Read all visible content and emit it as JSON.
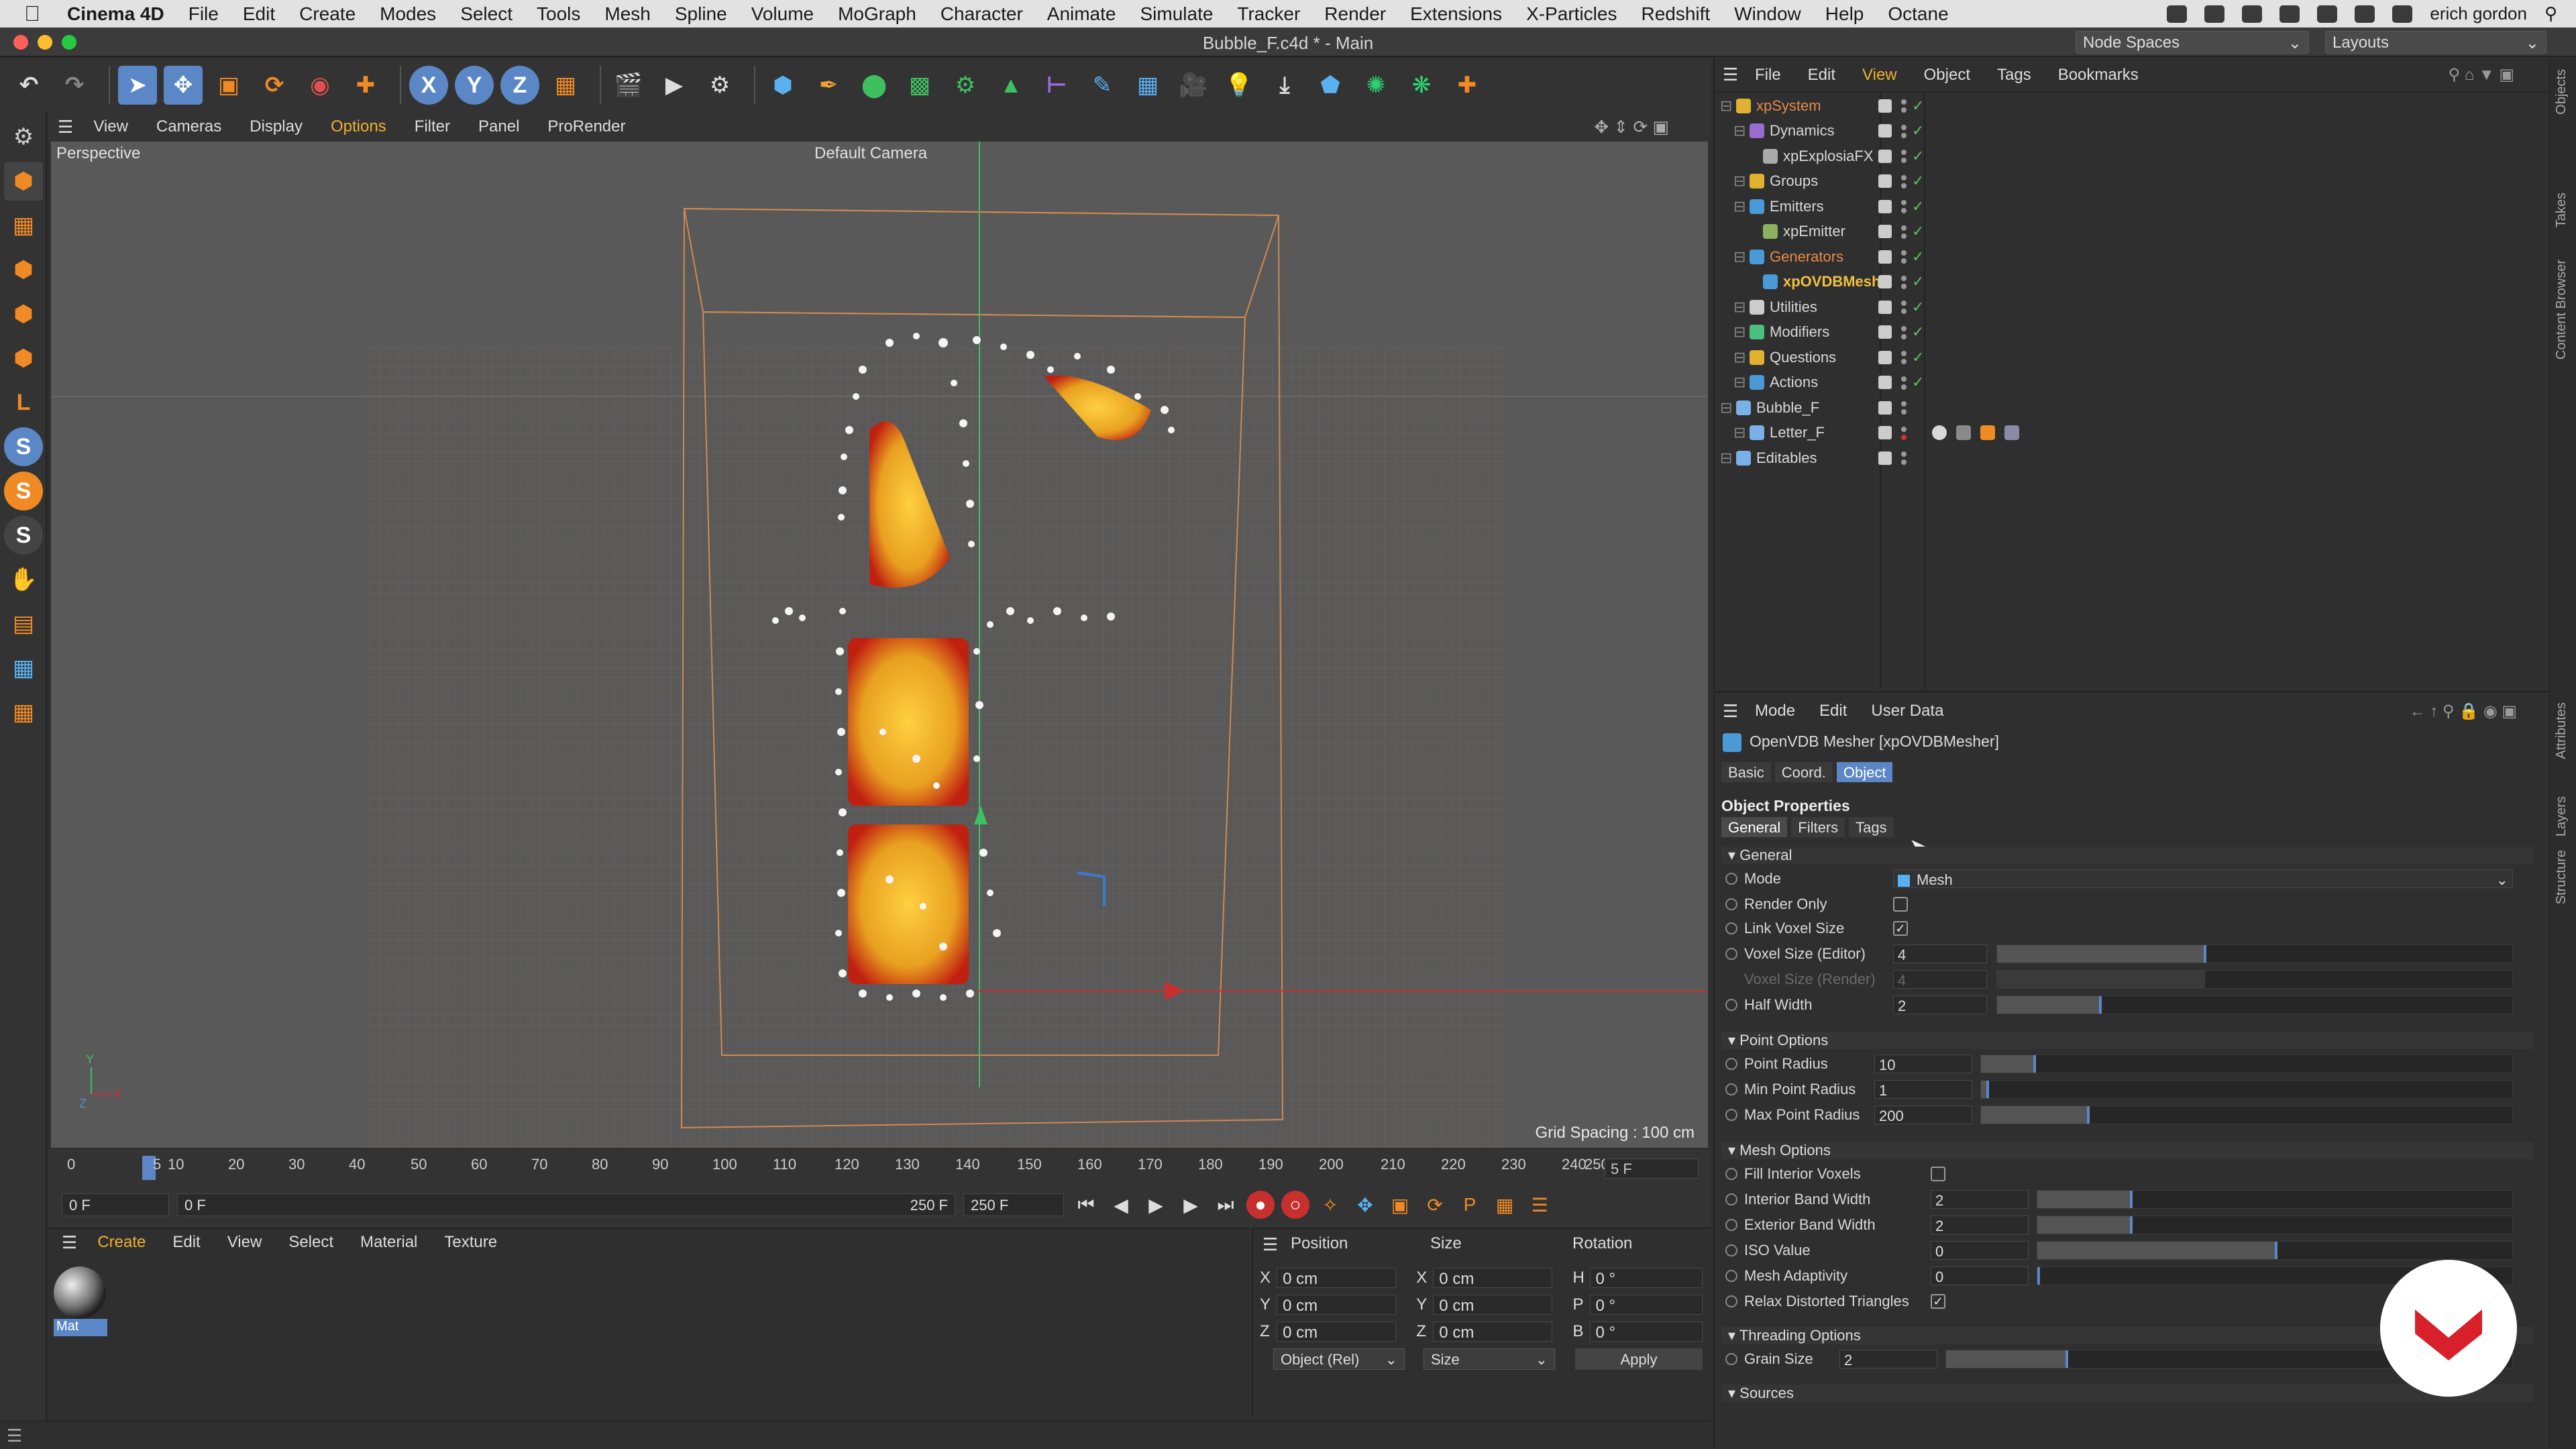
{
  "menubar": {
    "items": [
      "Cinema 4D",
      "File",
      "Edit",
      "Create",
      "Modes",
      "Select",
      "Tools",
      "Mesh",
      "Spline",
      "Volume",
      "MoGraph",
      "Character",
      "Animate",
      "Simulate",
      "Tracker",
      "Render",
      "Extensions",
      "X-Particles",
      "Redshift",
      "Window",
      "Help",
      "Octane"
    ],
    "user": "erich gordon"
  },
  "titlebar": {
    "title": "Bubble_F.c4d * - Main",
    "node_spaces": "Node Spaces",
    "layouts": "Layouts"
  },
  "viewport": {
    "menu": [
      "View",
      "Cameras",
      "Display",
      "Options",
      "Filter",
      "Panel",
      "ProRender"
    ],
    "active_menu": "Options",
    "label": "Perspective",
    "camera": "Default Camera",
    "grid_spacing": "Grid Spacing : 100 cm"
  },
  "timeline": {
    "ticks": [
      "0",
      "5",
      "10",
      "20",
      "30",
      "40",
      "50",
      "60",
      "70",
      "80",
      "90",
      "100",
      "110",
      "120",
      "130",
      "140",
      "150",
      "160",
      "170",
      "180",
      "190",
      "200",
      "210",
      "220",
      "230",
      "240",
      "250"
    ],
    "current_frame": "5 F",
    "start": "0 F",
    "current": "0 F",
    "end": "250 F",
    "end2": "250 F"
  },
  "materials": {
    "menu": [
      "Create",
      "Edit",
      "View",
      "Select",
      "Material",
      "Texture"
    ],
    "mat_name": "Mat"
  },
  "coords": {
    "headers": [
      "Position",
      "Size",
      "Rotation"
    ],
    "rows": [
      {
        "a": "X",
        "p": "0 cm",
        "sa": "X",
        "s": "0 cm",
        "ra": "H",
        "r": "0 °"
      },
      {
        "a": "Y",
        "p": "0 cm",
        "sa": "Y",
        "s": "0 cm",
        "ra": "P",
        "r": "0 °"
      },
      {
        "a": "Z",
        "p": "0 cm",
        "sa": "Z",
        "s": "0 cm",
        "ra": "B",
        "r": "0 °"
      }
    ],
    "mode": "Object (Rel)",
    "size_mode": "Size",
    "apply": "Apply"
  },
  "objects": {
    "menu": [
      "File",
      "Edit",
      "View",
      "Object",
      "Tags",
      "Bookmarks"
    ],
    "items": [
      {
        "name": "xpSystem",
        "indent": 0,
        "color": "#e8894a",
        "ic": "#e0b030"
      },
      {
        "name": "Dynamics",
        "indent": 1,
        "color": "#d8d8d8",
        "ic": "#9a6bd0"
      },
      {
        "name": "xpExplosiaFX",
        "indent": 2,
        "color": "#d8d8d8",
        "ic": "#aaaaaa"
      },
      {
        "name": "Groups",
        "indent": 1,
        "color": "#d8d8d8",
        "ic": "#e0b030"
      },
      {
        "name": "Emitters",
        "indent": 1,
        "color": "#d8d8d8",
        "ic": "#4a9ad8"
      },
      {
        "name": "xpEmitter",
        "indent": 2,
        "color": "#d8d8d8",
        "ic": "#8ab060"
      },
      {
        "name": "Generators",
        "indent": 1,
        "color": "#e8894a",
        "ic": "#4a9ad8"
      },
      {
        "name": "xpOVDBMesh",
        "indent": 2,
        "color": "#f0c040",
        "ic": "#4a9ad8"
      },
      {
        "name": "Utilities",
        "indent": 1,
        "color": "#d8d8d8",
        "ic": "#cccccc"
      },
      {
        "name": "Modifiers",
        "indent": 1,
        "color": "#d8d8d8",
        "ic": "#4ac080"
      },
      {
        "name": "Questions",
        "indent": 1,
        "color": "#d8d8d8",
        "ic": "#e0b030"
      },
      {
        "name": "Actions",
        "indent": 1,
        "color": "#d8d8d8",
        "ic": "#4a9ad8"
      },
      {
        "name": "Bubble_F",
        "indent": 0,
        "color": "#d8d8d8",
        "ic": "#7ab0e8"
      },
      {
        "name": "Letter_F",
        "indent": 1,
        "color": "#d8d8d8",
        "ic": "#7ab0e8"
      },
      {
        "name": "Editables",
        "indent": 0,
        "color": "#d8d8d8",
        "ic": "#7ab0e8"
      }
    ]
  },
  "attributes": {
    "menu": [
      "Mode",
      "Edit",
      "User Data"
    ],
    "title": "OpenVDB Mesher [xpOVDBMesher]",
    "tabs": [
      "Basic",
      "Coord.",
      "Object"
    ],
    "active_tab": "Object",
    "section_title": "Object Properties",
    "subtabs": [
      "General",
      "Filters",
      "Tags"
    ],
    "general": "General",
    "mode_label": "Mode",
    "mode_value": "Mesh",
    "render_only": "Render Only",
    "link_voxel": "Link Voxel Size",
    "voxel_editor": "Voxel Size (Editor)",
    "voxel_editor_v": "4",
    "voxel_render": "Voxel Size (Render)",
    "voxel_render_v": "4",
    "half_width": "Half Width",
    "half_width_v": "2",
    "point_options": "Point Options",
    "point_radius": "Point Radius",
    "point_radius_v": "10",
    "min_radius": "Min Point Radius",
    "min_radius_v": "1",
    "max_radius": "Max Point Radius",
    "max_radius_v": "200",
    "mesh_options": "Mesh Options",
    "fill_interior": "Fill Interior Voxels",
    "interior_band": "Interior Band Width",
    "interior_band_v": "2",
    "exterior_band": "Exterior Band Width",
    "exterior_band_v": "2",
    "iso": "ISO Value",
    "iso_v": "0",
    "adaptivity": "Mesh Adaptivity",
    "adaptivity_v": "0",
    "relax": "Relax Distorted Triangles",
    "threading": "Threading Options",
    "grain": "Grain Size",
    "grain_v": "2",
    "sources": "Sources"
  },
  "sidetabs": [
    "Objects",
    "Takes",
    "Content Browser",
    "Attributes",
    "Layers",
    "Structure"
  ]
}
